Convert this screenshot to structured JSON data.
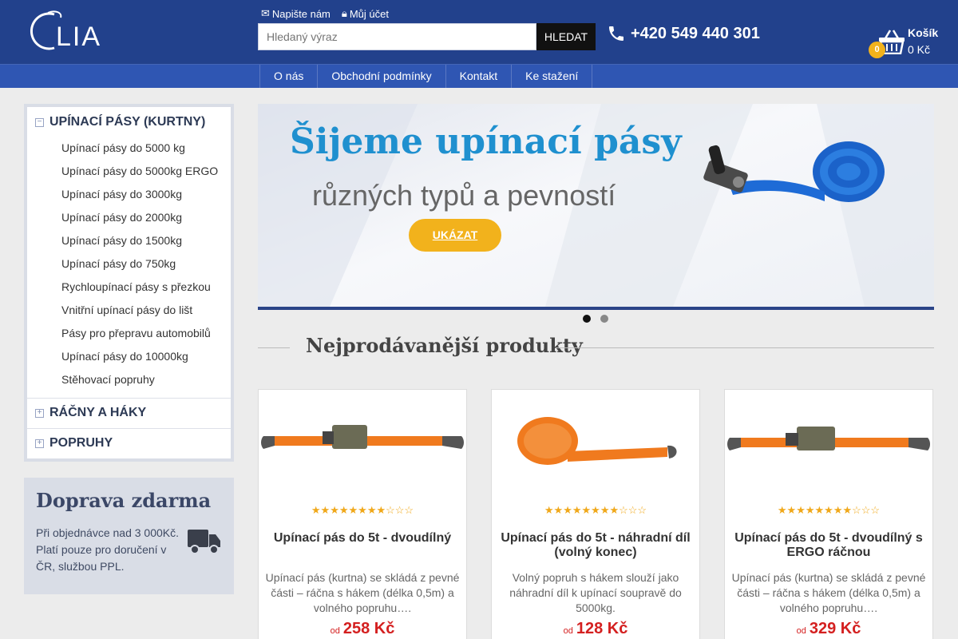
{
  "header": {
    "logo_text": "CLIA",
    "write_us": "Napište nám",
    "my_account": "Můj účet",
    "search_placeholder": "Hledaný výraz",
    "search_button": "HLEDAT",
    "phone": "+420 549 440 301",
    "cart_title": "Košík",
    "cart_total": "0 Kč",
    "cart_count": "0"
  },
  "nav": {
    "items": [
      {
        "label": "O nás"
      },
      {
        "label": "Obchodní podmínky"
      },
      {
        "label": "Kontakt"
      },
      {
        "label": "Ke stažení"
      }
    ]
  },
  "sidebar": {
    "categories": [
      {
        "label": "UPÍNACÍ PÁSY (KURTNY)",
        "toggle": "−",
        "expanded": true,
        "items": [
          "Upínací pásy do 5000 kg",
          "Upínací pásy do 5000kg ERGO",
          "Upínací pásy do 3000kg",
          "Upínací pásy do 2000kg",
          "Upínací pásy do 1500kg",
          "Upínací pásy do 750kg",
          "Rychloupínací pásy s přezkou",
          "Vnitřní upínací pásy do lišt",
          "Pásy pro přepravu automobilů",
          "Upínací pásy do 10000kg",
          "Stěhovací popruhy"
        ]
      },
      {
        "label": "RÁČNY A HÁKY",
        "toggle": "+",
        "expanded": false
      },
      {
        "label": "POPRUHY",
        "toggle": "+",
        "expanded": false
      }
    ],
    "shipping": {
      "title": "Doprava zdarma",
      "text": "Při objednávce nad 3 000Kč. Platí pouze pro doručení v ČR, službou PPL."
    }
  },
  "banner": {
    "title": "Šijeme upínací pásy",
    "subtitle": "různých typů a pevností",
    "button": "UKÁZAT",
    "slides": 2,
    "active_slide": 1
  },
  "bestsellers": {
    "title": "Nejprodávanější produkty",
    "products": [
      {
        "name": "Upínací pás do 5t - dvoudílný",
        "rating": 8,
        "rating_max": 11,
        "description": "Upínací pás (kurtna) se skládá z pevné části – ráčna s hákem (délka 0,5m) a volného popruhu….",
        "price_prefix": "od",
        "price": "258 Kč"
      },
      {
        "name": "Upínací pás do 5t - náhradní díl (volný konec)",
        "rating": 8,
        "rating_max": 11,
        "description": "Volný popruh s hákem slouží jako náhradní díl k upínací soupravě do 5000kg.",
        "price_prefix": "od",
        "price": "128 Kč"
      },
      {
        "name": "Upínací pás do 5t - dvoudílný s ERGO ráčnou",
        "rating": 8,
        "rating_max": 11,
        "description": "Upínací pás (kurtna) se skládá z pevné části – ráčna s hákem (délka 0,5m) a volného popruhu….",
        "price_prefix": "od",
        "price": "329 Kč"
      }
    ]
  },
  "colors": {
    "header_bg": "#22418c",
    "nav_bg": "#2f56b3",
    "accent_yellow": "#f2b21c",
    "banner_title": "#1f90cf",
    "price_red": "#d42020"
  }
}
